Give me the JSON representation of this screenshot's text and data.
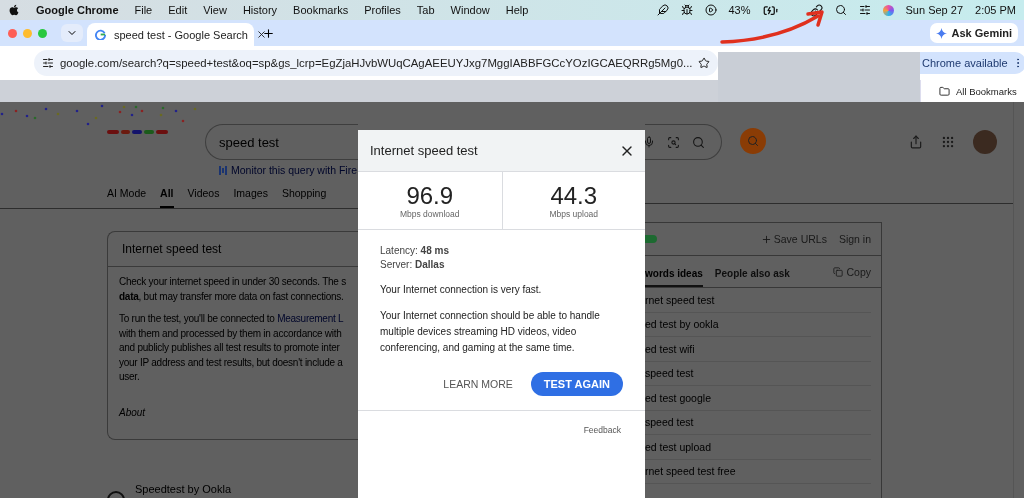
{
  "menu_bar": {
    "app": "Google Chrome",
    "menus": [
      "File",
      "Edit",
      "View",
      "History",
      "Bookmarks",
      "Profiles",
      "Tab",
      "Window",
      "Help"
    ],
    "battery": "43%",
    "date": "Sun Sep 27",
    "time": "2:05 PM"
  },
  "browser": {
    "tab": {
      "title": "speed test - Google Search",
      "selected": true
    },
    "ask_gemini": "Ask Gemini",
    "url": "google.com/search?q=speed+test&oq=sp&gs_lcrp=EgZjaHJvbWUqCAgAEEUYJxg7MggIABBFGCcYOzIGCAEQRRg5Mg0...",
    "chrome_available": "Chrome available",
    "bookmarks": "All Bookmarks"
  },
  "search_page": {
    "query": "speed test",
    "monitor": "Monitor this query with Fire",
    "tabs": [
      {
        "label": "AI Mode",
        "selected": false
      },
      {
        "label": "All",
        "selected": true
      },
      {
        "label": "Videos",
        "selected": false
      },
      {
        "label": "Images",
        "selected": false
      },
      {
        "label": "Shopping",
        "selected": false
      }
    ],
    "card": {
      "title": "Internet speed test",
      "paragraph_1": "Check your internet speed in under 30 seconds. The s\n**data**, but may transfer more data on fast connections.",
      "paragraph_2_before": "To run the test, you'll be connected to ",
      "paragraph_2_link": "Measurement L",
      "paragraph_2_after": "\nwith them and processed by them in accordance with\nand publicly publishes all test results to promote inter\nyour IP address and test results, but doesn't include a\nuser.",
      "about": "About"
    },
    "result": "Speedtest by Ookla",
    "side_panel": {
      "toggle": {
        "on": true
      },
      "save_urls": "Save URLs",
      "sign_in": "Sign in",
      "tabs": [
        {
          "label": "words ideas",
          "selected": true
        },
        {
          "label": "People also ask",
          "selected": false
        }
      ],
      "copy": "Copy",
      "keywords": [
        "rnet speed test",
        "ed test by ookla",
        "ed test wifi",
        "speed test",
        "ed test google",
        "speed test",
        "ed test upload",
        "rnet speed test free"
      ]
    }
  },
  "dialog": {
    "title": "Internet speed test",
    "stats": [
      {
        "value": "96.9",
        "label": "Mbps download"
      },
      {
        "value": "44.3",
        "label": "Mbps upload"
      }
    ],
    "latency": "Latency: **48 ms**",
    "server": "Server: **Dallas**",
    "verdict": "Your Internet connection is very fast.",
    "description": "Your Internet connection should be able to handle multiple devices streaming HD videos, video conferencing, and gaming at the same time.",
    "learn_more": "LEARN MORE",
    "test_again": "TEST AGAIN",
    "feedback": "Feedback"
  }
}
